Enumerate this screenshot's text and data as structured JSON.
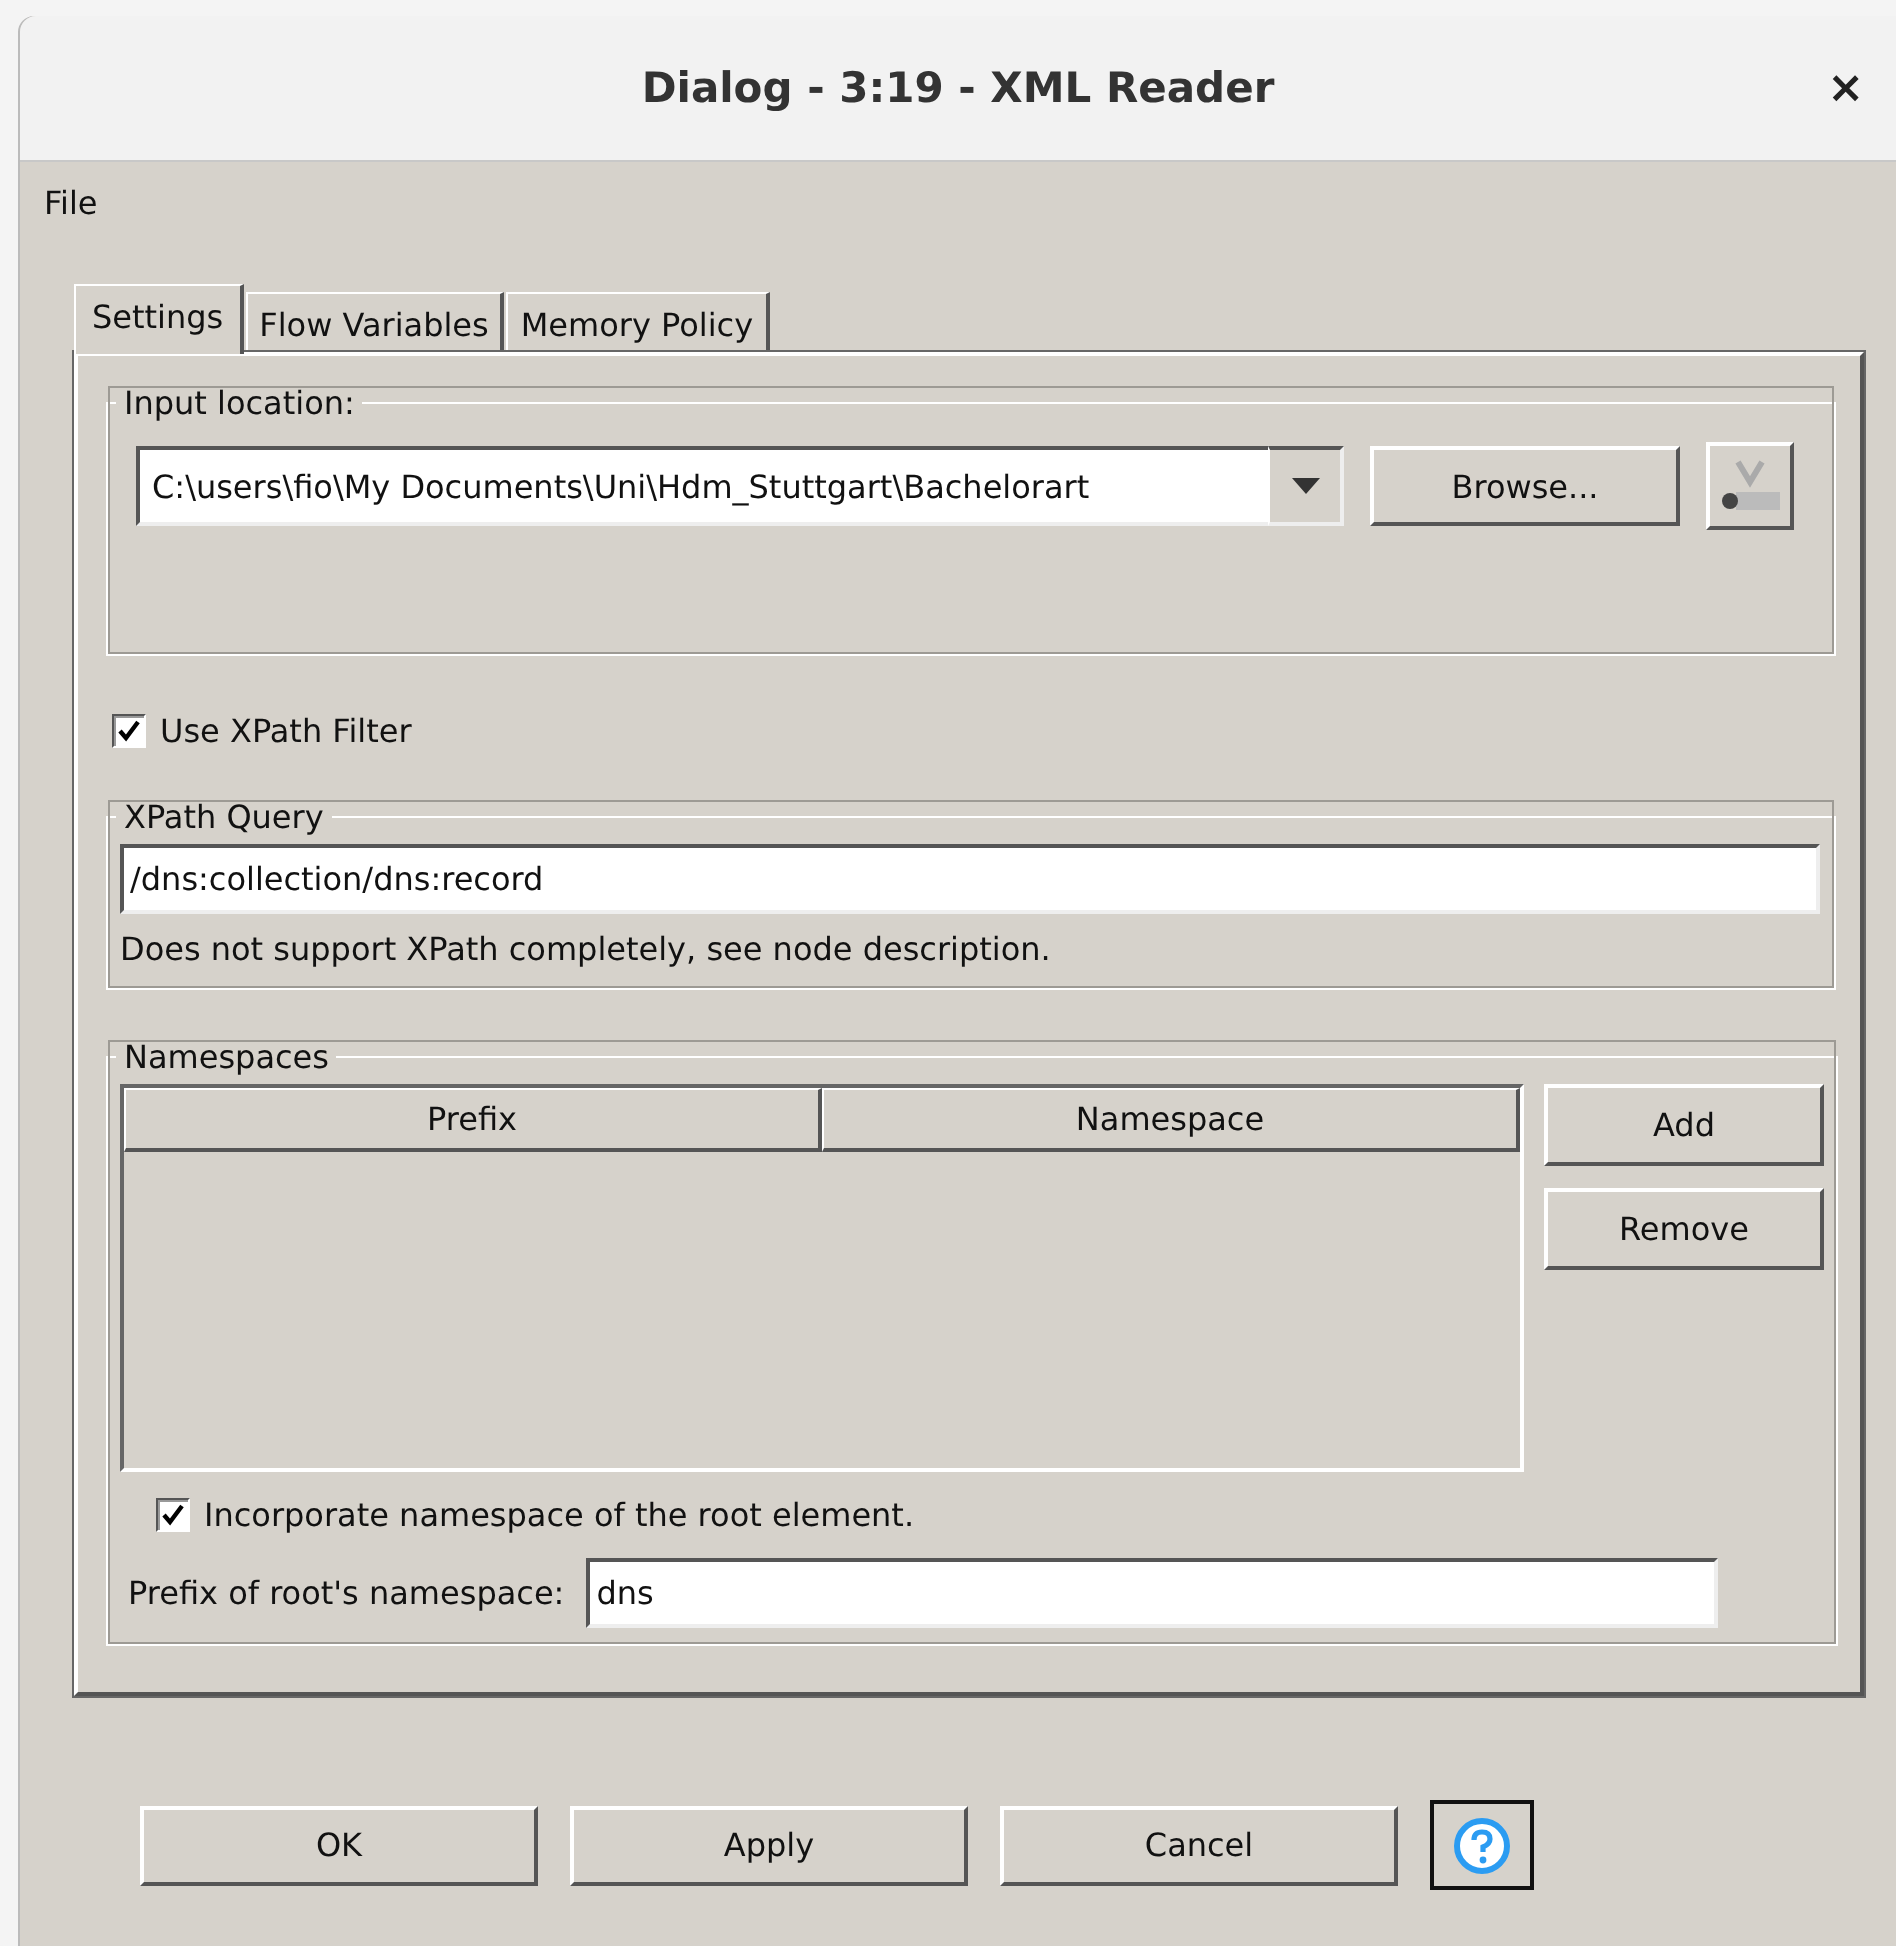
{
  "window": {
    "title": "Dialog - 3:19 - XML Reader",
    "close": "×"
  },
  "menu": [
    "File"
  ],
  "tabs": [
    {
      "label": "Settings",
      "selected": true
    },
    {
      "label": "Flow Variables",
      "selected": false
    },
    {
      "label": "Memory Policy",
      "selected": false
    }
  ],
  "input_location": {
    "label": "Input location:",
    "value": "C:\\users\\fio\\My Documents\\Uni\\Hdm_Stuttgart\\Bachelorart",
    "browse": "Browse..."
  },
  "use_xpath_filter": {
    "label": "Use XPath Filter",
    "checked": true
  },
  "xpath_query": {
    "label": "XPath Query",
    "value": "/dns:collection/dns:record",
    "note": "Does not support XPath completely, see node description."
  },
  "namespaces": {
    "label": "Namespaces",
    "columns": [
      "Prefix",
      "Namespace"
    ],
    "buttons": [
      "Add",
      "Remove"
    ],
    "incorporate": {
      "label": "Incorporate namespace of the root element.",
      "checked": true
    },
    "prefix_field": {
      "label": "Prefix of root's namespace:",
      "value": "dns"
    }
  },
  "buttons": [
    "OK",
    "Apply",
    "Cancel"
  ]
}
